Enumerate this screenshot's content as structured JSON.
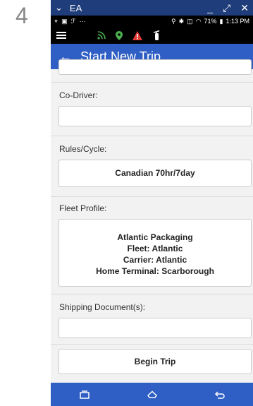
{
  "step_number": "4",
  "window": {
    "title": "EA",
    "minimize": "_",
    "restore": "⤢",
    "close": "✕"
  },
  "status_bar": {
    "left_icons": [
      "location-icon",
      "screen-icon",
      "cast-icon",
      "more-icon"
    ],
    "battery": "71%",
    "time": "1:13 PM"
  },
  "app_bar": {
    "icons": [
      "rss-icon",
      "map-pin-icon",
      "warning-icon",
      "extinguisher-icon"
    ],
    "colors": {
      "rss": "#4caf50",
      "pin": "#4caf50",
      "warning": "#e53935",
      "extinguisher": "#ffffff"
    }
  },
  "title_bar": {
    "back": "←",
    "title": "Start New Trip"
  },
  "form": {
    "co_driver_label": "Co-Driver:",
    "co_driver_value": "",
    "rules_label": "Rules/Cycle:",
    "rules_value": "Canadian 70hr/7day",
    "fleet_label": "Fleet Profile:",
    "fleet_lines": [
      "Atlantic Packaging",
      "Fleet: Atlantic",
      "Carrier: Atlantic",
      "Home Terminal: Scarborough"
    ],
    "shipping_label": "Shipping Document(s):",
    "shipping_value": "",
    "begin_button": "Begin Trip"
  },
  "accent_color": "#2f5ec4"
}
